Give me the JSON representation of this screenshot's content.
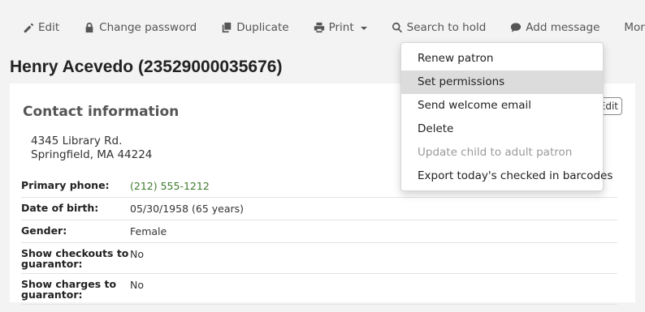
{
  "toolbar": {
    "edit_label": "Edit",
    "change_password_label": "Change password",
    "duplicate_label": "Duplicate",
    "print_label": "Print",
    "search_to_hold_label": "Search to hold",
    "add_message_label": "Add message",
    "more_label": "More"
  },
  "patron": {
    "title": "Henry Acevedo (23529000035676)"
  },
  "contact": {
    "heading": "Contact information",
    "edit_label": "Edit",
    "address_line1": "4345 Library Rd.",
    "address_line2": "Springfield, MA 44224",
    "fields": [
      {
        "label": "Primary phone:",
        "value": "(212) 555-1212"
      },
      {
        "label": "Date of birth:",
        "value": "05/30/1958 (65 years)"
      },
      {
        "label": "Gender:",
        "value": "Female"
      },
      {
        "label": "Show checkouts to guarantor:",
        "value": "No"
      },
      {
        "label": "Show charges to guarantor:",
        "value": "No"
      }
    ]
  },
  "more_menu": {
    "items": [
      {
        "label": "Renew patron",
        "state": "normal"
      },
      {
        "label": "Set permissions",
        "state": "hovered"
      },
      {
        "label": "Send welcome email",
        "state": "normal"
      },
      {
        "label": "Delete",
        "state": "normal"
      },
      {
        "label": "Update child to adult patron",
        "state": "disabled"
      },
      {
        "label": "Export today's checked in barcodes",
        "state": "normal"
      }
    ]
  },
  "colors": {
    "phone_link": "#3c7a2a",
    "hover_bg": "#dcdcdc",
    "disabled_text": "#9a9a9a"
  }
}
